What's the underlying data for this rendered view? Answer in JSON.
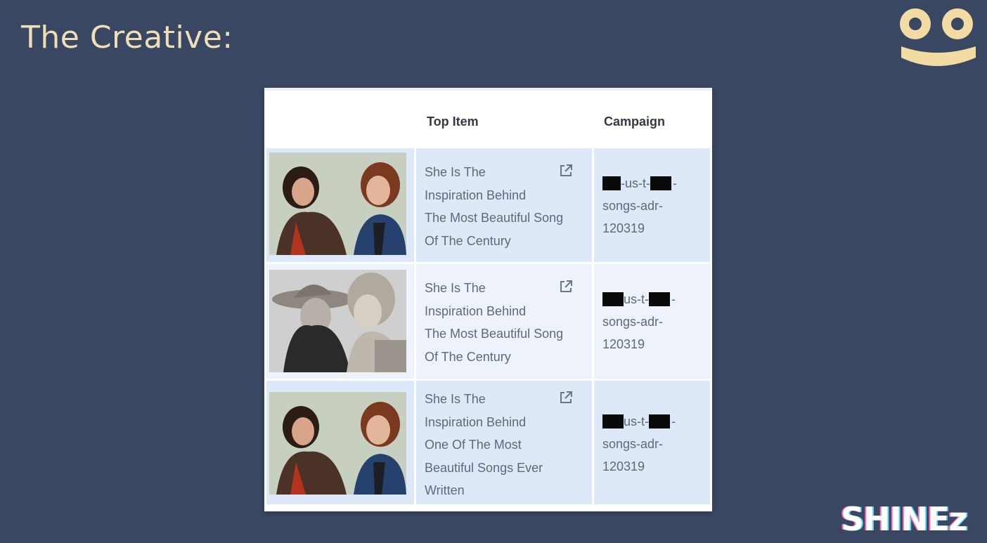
{
  "slide": {
    "title": "The Creative:"
  },
  "brand": {
    "logo_icon": "smiley-face-logo-icon",
    "wordmark": "SHINEz",
    "logo_color": "#f3dca4"
  },
  "table": {
    "columns": [
      "",
      "Top Item",
      "Campaign"
    ],
    "rows": [
      {
        "thumbnail": "photo-man-and-woman-1970s",
        "title": "She Is The Inspiration Behind The Most Beautiful Song Of The Century",
        "title_lines": [
          "She Is The",
          "Inspiration Behind",
          "The Most Beautiful Song",
          "Of The Century"
        ],
        "campaign_lines": [
          "-us-t-",
          "songs-adr-",
          "120319"
        ],
        "external_icon": "external-link-icon"
      },
      {
        "thumbnail": "photo-woman-in-hat-and-man-bw",
        "title": "She Is The Inspiration Behind The Most Beautiful Song Of The Century",
        "title_lines": [
          "She Is The",
          "Inspiration Behind",
          "The Most Beautiful Song",
          "Of The Century"
        ],
        "campaign_lines": [
          "us-t-",
          "songs-adr-",
          "120319"
        ],
        "external_icon": "external-link-icon"
      },
      {
        "thumbnail": "photo-man-and-woman-1970s",
        "title": "She Is The Inspiration Behind One Of The Most Beautiful Songs Ever Written",
        "title_lines": [
          "She Is The",
          "Inspiration Behind",
          "One Of The Most",
          "Beautiful Songs Ever",
          "Written"
        ],
        "campaign_lines": [
          "us-t-",
          "songs-adr-",
          "120319"
        ],
        "external_icon": "external-link-icon"
      }
    ]
  },
  "colors": {
    "background": "#3a4762",
    "title": "#eedfb6",
    "row_blue": "#dde8f8",
    "row_light": "#eef3fb"
  }
}
